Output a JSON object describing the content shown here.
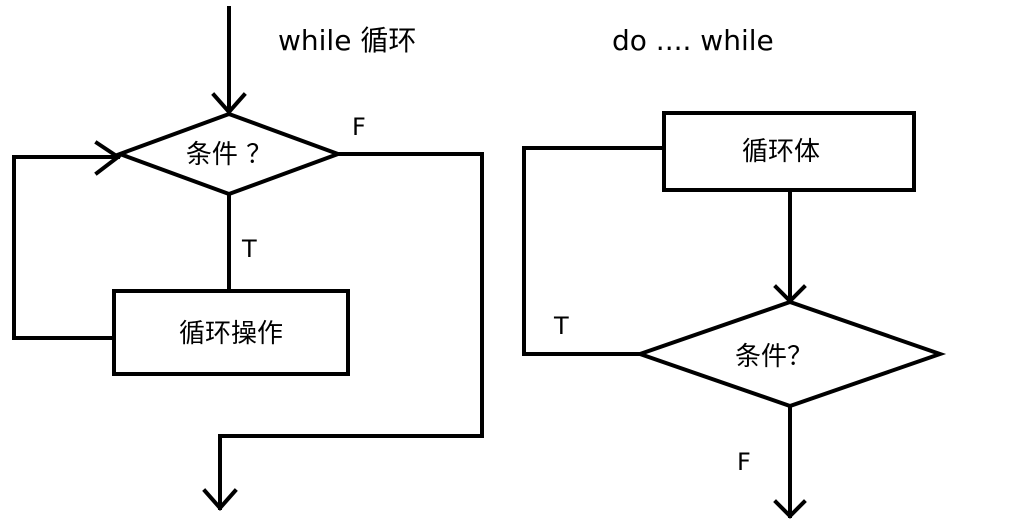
{
  "while_loop": {
    "title": "while 循环",
    "condition": "条件 ？",
    "body": "循环操作",
    "true_label": "T",
    "false_label": "F"
  },
  "do_while_loop": {
    "title": "do .... while",
    "body": "循环体",
    "condition": "条件？",
    "true_label": "T",
    "false_label": "F"
  }
}
